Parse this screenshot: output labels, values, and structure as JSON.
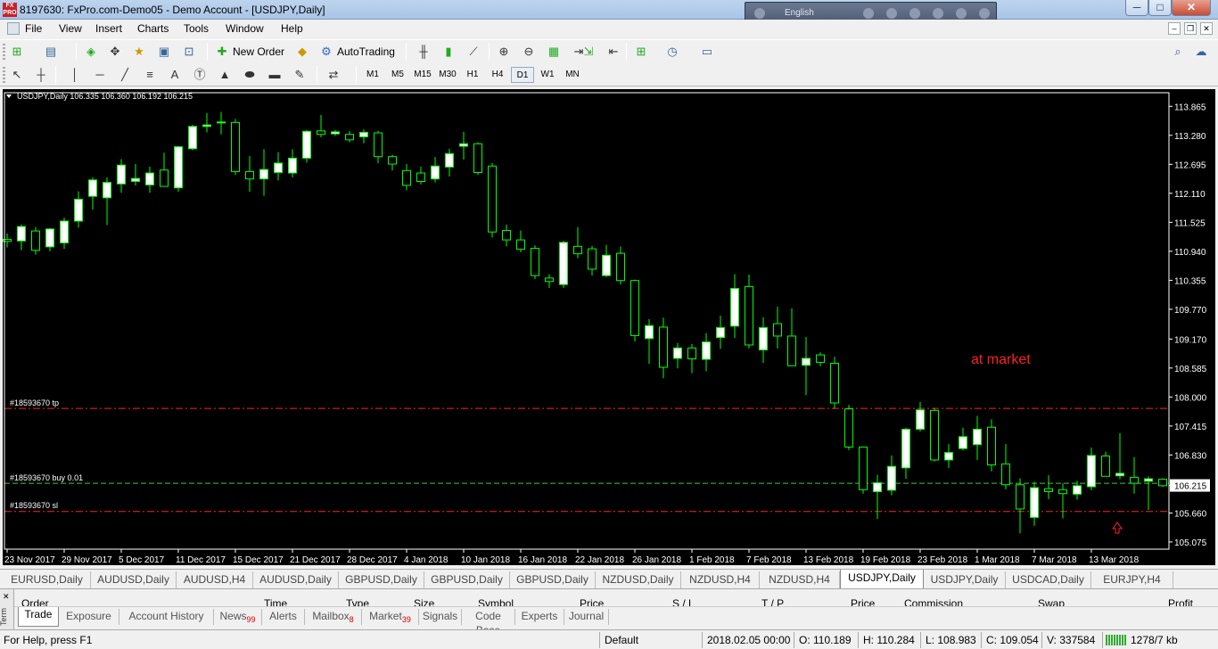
{
  "window": {
    "icon_text": "FX PRO",
    "title": "8197630: FxPro.com-Demo05 - Demo Account - [USDJPY,Daily]",
    "language": "English",
    "min": "─",
    "max": "□",
    "close": "✕"
  },
  "menu": {
    "items": [
      "File",
      "View",
      "Insert",
      "Charts",
      "Tools",
      "Window",
      "Help"
    ],
    "mdi": [
      "–",
      "❐",
      "✕"
    ]
  },
  "toolbar": {
    "new_order": "New Order",
    "auto_trading": "AutoTrading"
  },
  "timeframes": [
    "M1",
    "M5",
    "M15",
    "M30",
    "H1",
    "H4",
    "D1",
    "W1",
    "MN"
  ],
  "active_timeframe": "D1",
  "chart": {
    "header": "USDJPY,Daily  106.335 106.360 106.192 106.215",
    "bull_color": "#ffffff",
    "bear_color": "#000000",
    "wick_color": "#00ff00",
    "background": "#000000",
    "tp_label": "#18593670 tp",
    "buy_label": "#18593670 buy 0.01",
    "sl_label": "#18593670 sl",
    "annotation": "at market",
    "current_price": "106.215"
  },
  "chart_data": {
    "type": "candlestick",
    "symbol": "USDJPY",
    "timeframe": "Daily",
    "ylim": [
      104.93,
      114.14
    ],
    "y_ticks": [
      "113.865",
      "113.280",
      "112.695",
      "112.110",
      "111.525",
      "110.940",
      "110.355",
      "109.770",
      "109.170",
      "108.585",
      "108.000",
      "107.415",
      "106.830",
      "106.215",
      "105.660",
      "105.075"
    ],
    "x_ticks": [
      "23 Nov 2017",
      "29 Nov 2017",
      "5 Dec 2017",
      "11 Dec 2017",
      "15 Dec 2017",
      "21 Dec 2017",
      "28 Dec 2017",
      "4 Jan 2018",
      "10 Jan 2018",
      "16 Jan 2018",
      "22 Jan 2018",
      "26 Jan 2018",
      "1 Feb 2018",
      "7 Feb 2018",
      "13 Feb 2018",
      "19 Feb 2018",
      "23 Feb 2018",
      "1 Mar 2018",
      "7 Mar 2018",
      "13 Mar 2018"
    ],
    "levels": {
      "tp": 107.77,
      "buy": 106.26,
      "sl": 105.69
    },
    "candles": [
      [
        111.18,
        111.3,
        111.02,
        111.14
      ],
      [
        111.15,
        111.48,
        110.96,
        111.44
      ],
      [
        111.35,
        111.43,
        110.87,
        110.96
      ],
      [
        111.03,
        111.41,
        110.94,
        111.39
      ],
      [
        111.11,
        111.62,
        110.99,
        111.55
      ],
      [
        111.55,
        112.15,
        111.42,
        111.99
      ],
      [
        112.05,
        112.43,
        111.78,
        112.38
      ],
      [
        112.02,
        112.43,
        111.47,
        112.33
      ],
      [
        112.3,
        112.8,
        112.12,
        112.68
      ],
      [
        112.35,
        112.7,
        112.27,
        112.41
      ],
      [
        112.28,
        112.65,
        112.12,
        112.52
      ],
      [
        112.58,
        112.93,
        112.27,
        112.25
      ],
      [
        112.22,
        113.07,
        112.14,
        113.05
      ],
      [
        113.01,
        113.49,
        112.98,
        113.46
      ],
      [
        113.46,
        113.73,
        113.34,
        113.49
      ],
      [
        113.53,
        113.75,
        113.3,
        113.55
      ],
      [
        113.54,
        113.61,
        112.48,
        112.55
      ],
      [
        112.55,
        112.86,
        112.14,
        112.4
      ],
      [
        112.4,
        113.0,
        112.06,
        112.59
      ],
      [
        112.53,
        112.94,
        112.37,
        112.72
      ],
      [
        112.52,
        113.0,
        112.43,
        112.82
      ],
      [
        112.82,
        113.39,
        112.73,
        113.36
      ],
      [
        113.37,
        113.69,
        113.24,
        113.3
      ],
      [
        113.31,
        113.39,
        113.27,
        113.35
      ],
      [
        113.3,
        113.37,
        113.14,
        113.19
      ],
      [
        113.25,
        113.4,
        113.12,
        113.34
      ],
      [
        113.33,
        113.37,
        112.72,
        112.85
      ],
      [
        112.85,
        112.89,
        112.57,
        112.7
      ],
      [
        112.57,
        112.7,
        112.17,
        112.27
      ],
      [
        112.52,
        112.65,
        112.29,
        112.35
      ],
      [
        112.4,
        112.84,
        112.33,
        112.66
      ],
      [
        112.64,
        113.01,
        112.45,
        112.91
      ],
      [
        113.06,
        113.35,
        112.79,
        113.11
      ],
      [
        113.11,
        113.14,
        112.48,
        112.53
      ],
      [
        112.66,
        112.72,
        111.22,
        111.33
      ],
      [
        111.36,
        111.48,
        111.04,
        111.17
      ],
      [
        111.17,
        111.36,
        110.92,
        110.98
      ],
      [
        111.0,
        111.06,
        110.38,
        110.45
      ],
      [
        110.4,
        110.48,
        110.2,
        110.33
      ],
      [
        110.27,
        111.15,
        110.2,
        111.12
      ],
      [
        111.04,
        111.43,
        110.8,
        110.89
      ],
      [
        110.99,
        111.05,
        110.45,
        110.58
      ],
      [
        110.45,
        111.07,
        110.42,
        110.86
      ],
      [
        110.9,
        111.04,
        110.27,
        110.35
      ],
      [
        110.35,
        110.37,
        109.12,
        109.24
      ],
      [
        109.18,
        109.57,
        108.67,
        109.44
      ],
      [
        109.41,
        109.6,
        108.38,
        108.6
      ],
      [
        108.78,
        109.09,
        108.58,
        108.99
      ],
      [
        108.99,
        109.07,
        108.48,
        108.77
      ],
      [
        108.76,
        109.29,
        108.52,
        109.11
      ],
      [
        109.2,
        109.64,
        108.97,
        109.4
      ],
      [
        109.43,
        110.48,
        109.19,
        110.19
      ],
      [
        110.23,
        110.47,
        108.98,
        109.05
      ],
      [
        108.95,
        109.61,
        108.69,
        109.4
      ],
      [
        109.48,
        109.82,
        108.98,
        109.23
      ],
      [
        109.23,
        109.79,
        108.63,
        108.63
      ],
      [
        108.64,
        109.21,
        108.04,
        108.78
      ],
      [
        108.85,
        108.9,
        108.62,
        108.7
      ],
      [
        108.68,
        108.81,
        107.76,
        107.88
      ],
      [
        107.76,
        107.84,
        106.93,
        106.99
      ],
      [
        106.99,
        106.99,
        106.05,
        106.13
      ],
      [
        106.09,
        106.43,
        105.54,
        106.27
      ],
      [
        106.12,
        106.82,
        106.02,
        106.6
      ],
      [
        106.57,
        107.38,
        106.35,
        107.35
      ],
      [
        107.35,
        107.9,
        107.3,
        107.74
      ],
      [
        107.73,
        107.78,
        106.7,
        106.73
      ],
      [
        106.73,
        107.05,
        106.57,
        106.88
      ],
      [
        106.96,
        107.38,
        106.92,
        107.2
      ],
      [
        107.04,
        107.62,
        106.73,
        107.35
      ],
      [
        107.39,
        107.55,
        106.5,
        106.63
      ],
      [
        106.65,
        107.05,
        106.14,
        106.23
      ],
      [
        106.23,
        106.36,
        105.25,
        105.74
      ],
      [
        105.57,
        106.29,
        105.4,
        106.17
      ],
      [
        106.15,
        106.42,
        105.94,
        106.09
      ],
      [
        106.13,
        106.26,
        105.55,
        106.05
      ],
      [
        106.04,
        106.31,
        105.93,
        106.21
      ],
      [
        106.19,
        106.98,
        106.12,
        106.82
      ],
      [
        106.81,
        106.9,
        106.45,
        106.4
      ],
      [
        106.41,
        107.27,
        106.34,
        106.46
      ],
      [
        106.38,
        106.79,
        106.05,
        106.26
      ],
      [
        106.3,
        106.4,
        105.72,
        106.35
      ],
      [
        106.34,
        106.36,
        106.19,
        106.21
      ]
    ]
  },
  "chart_tabs": [
    "EURUSD,Daily",
    "AUDUSD,Daily",
    "AUDUSD,H4",
    "AUDUSD,Daily",
    "GBPUSD,Daily",
    "GBPUSD,Daily",
    "GBPUSD,Daily",
    "NZDUSD,Daily",
    "NZDUSD,H4",
    "NZDUSD,H4",
    "USDJPY,Daily",
    "USDJPY,Daily",
    "USDCAD,Daily",
    "EURJPY,H4"
  ],
  "active_chart_tab": 10,
  "terminal": {
    "side_label": "Term",
    "close": "✕",
    "columns": [
      "Order",
      "Time",
      "Type",
      "Size",
      "Symbol",
      "Price",
      "S / L",
      "T / P",
      "Price",
      "Commission",
      "Swap",
      "Profit"
    ],
    "tabs": [
      {
        "label": "Trade",
        "badge": ""
      },
      {
        "label": "Exposure",
        "badge": ""
      },
      {
        "label": "Account History",
        "badge": ""
      },
      {
        "label": "News",
        "badge": "99"
      },
      {
        "label": "Alerts",
        "badge": ""
      },
      {
        "label": "Mailbox",
        "badge": "8"
      },
      {
        "label": "Market",
        "badge": "39"
      },
      {
        "label": "Signals",
        "badge": ""
      },
      {
        "label": "Code Base",
        "badge": ""
      },
      {
        "label": "Experts",
        "badge": ""
      },
      {
        "label": "Journal",
        "badge": ""
      }
    ]
  },
  "status": {
    "help": "For Help, press F1",
    "profile": "Default",
    "datetime": "2018.02.05 00:00",
    "open": "O: 110.189",
    "high": "H: 110.284",
    "low": "L: 108.983",
    "close": "C: 109.054",
    "volume": "V: 337584",
    "traffic": "1278/7 kb"
  }
}
